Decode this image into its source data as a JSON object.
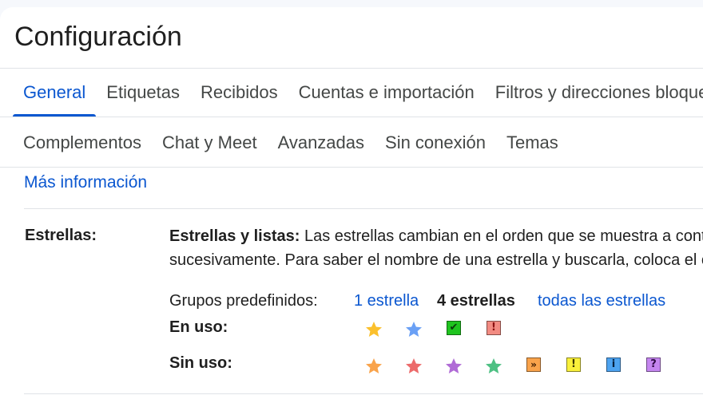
{
  "page": {
    "title": "Configuración"
  },
  "tabs_row1": [
    {
      "label": "General",
      "active": true
    },
    {
      "label": "Etiquetas"
    },
    {
      "label": "Recibidos"
    },
    {
      "label": "Cuentas e importación"
    },
    {
      "label": "Filtros y direcciones bloqueadas"
    }
  ],
  "tabs_row2": [
    {
      "label": "Complementos"
    },
    {
      "label": "Chat y Meet"
    },
    {
      "label": "Avanzadas"
    },
    {
      "label": "Sin conexión"
    },
    {
      "label": "Temas"
    }
  ],
  "more_info": "Más información",
  "stars": {
    "label": "Estrellas:",
    "desc_bold": "Estrellas y listas:",
    "desc_line1": " Las estrellas cambian en el orden que se muestra a continuación al hacer clic",
    "desc_line2": "sucesivamente. Para saber el nombre de una estrella y buscarla, coloca el cursor sobre ella.",
    "presets_label": "Grupos predefinidos:",
    "preset_1": "1 estrella",
    "preset_4": "4 estrellas",
    "preset_all": "todas las estrellas",
    "in_use_label": "En uso:",
    "not_in_use_label": "Sin uso:",
    "in_use_icons": [
      {
        "name": "yellow-star-icon",
        "color": "#fbc02d"
      },
      {
        "name": "blue-star-icon",
        "color": "#6aa0f5"
      },
      {
        "name": "green-check-icon",
        "color": "#1fc41f"
      },
      {
        "name": "red-bang-icon",
        "color": "#f28b82"
      }
    ],
    "not_in_use_icons": [
      {
        "name": "orange-star-icon",
        "color": "#f9a34b"
      },
      {
        "name": "red-star-icon",
        "color": "#ec6b6b"
      },
      {
        "name": "purple-star-icon",
        "color": "#b06bd6"
      },
      {
        "name": "green-star-icon",
        "color": "#4ec083"
      },
      {
        "name": "orange-guillemet-icon",
        "color": "#f9a34b"
      },
      {
        "name": "yellow-bang-icon",
        "color": "#f9f03b"
      },
      {
        "name": "blue-info-icon",
        "color": "#4da3f0"
      },
      {
        "name": "purple-question-icon",
        "color": "#c586f0"
      }
    ]
  }
}
